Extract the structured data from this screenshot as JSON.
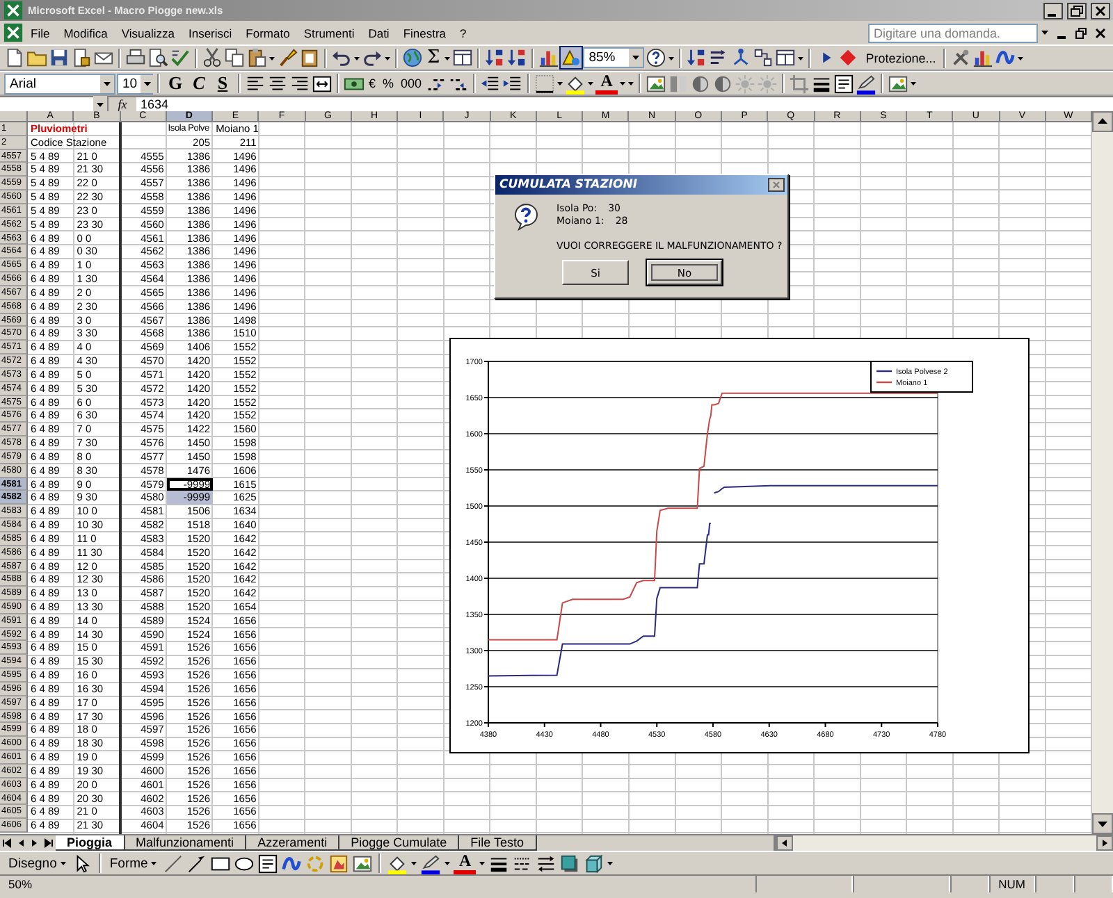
{
  "window": {
    "title": "Microsoft Excel - Macro Piogge new.xls"
  },
  "menu": {
    "items": [
      "File",
      "Modifica",
      "Visualizza",
      "Inserisci",
      "Formato",
      "Strumenti",
      "Dati",
      "Finestra",
      "?"
    ],
    "help_search": {
      "placeholder": "Digitare una domanda."
    }
  },
  "standard_toolbar": {
    "autosum": "Σ",
    "zoom": "85%",
    "protection": "Protezione..."
  },
  "formatting_toolbar": {
    "font": "Arial",
    "size": "10",
    "bold": "G",
    "italic": "C",
    "underline": "S",
    "euro": "€",
    "percent": "%",
    "thousands": "000",
    "font_color": "A"
  },
  "formula_bar": {
    "function_label": "fx",
    "value": "1634"
  },
  "sheet": {
    "columns": [
      {
        "label": "A",
        "selected": false
      },
      {
        "label": "B",
        "selected": false
      },
      {
        "label": "C",
        "selected": false
      },
      {
        "label": "D",
        "selected": true
      },
      {
        "label": "E",
        "selected": false
      },
      {
        "label": "F",
        "selected": false
      },
      {
        "label": "G",
        "selected": false
      },
      {
        "label": "H",
        "selected": false
      },
      {
        "label": "I",
        "selected": false
      },
      {
        "label": "J",
        "selected": false
      },
      {
        "label": "K",
        "selected": false
      },
      {
        "label": "L",
        "selected": false
      },
      {
        "label": "M",
        "selected": false
      },
      {
        "label": "N",
        "selected": false
      },
      {
        "label": "O",
        "selected": false
      },
      {
        "label": "P",
        "selected": false
      },
      {
        "label": "Q",
        "selected": false
      },
      {
        "label": "R",
        "selected": false
      },
      {
        "label": "S",
        "selected": false
      },
      {
        "label": "T",
        "selected": false
      },
      {
        "label": "U",
        "selected": false
      },
      {
        "label": "V",
        "selected": false
      },
      {
        "label": "W",
        "selected": false
      }
    ],
    "rows": [
      {
        "number": "1",
        "kind": "title",
        "A": "Pluviometri",
        "D": "Isola Polve",
        "E": "Moiano 1",
        "selected": false,
        "active": false
      },
      {
        "number": "2",
        "kind": "data",
        "A": "Codice Stazione",
        "D": "205",
        "E": "211",
        "selected": false,
        "active": false
      },
      {
        "number": "4557",
        "kind": "data",
        "A": "5 4 89",
        "B": "21 0",
        "C": "4555",
        "D": "1386",
        "E": "1496",
        "selected": false,
        "active": false
      },
      {
        "number": "4558",
        "kind": "data",
        "A": "5 4 89",
        "B": "21 30",
        "C": "4556",
        "D": "1386",
        "E": "1496",
        "selected": false,
        "active": false
      },
      {
        "number": "4559",
        "kind": "data",
        "A": "5 4 89",
        "B": "22 0",
        "C": "4557",
        "D": "1386",
        "E": "1496",
        "selected": false,
        "active": false
      },
      {
        "number": "4560",
        "kind": "data",
        "A": "5 4 89",
        "B": "22 30",
        "C": "4558",
        "D": "1386",
        "E": "1496",
        "selected": false,
        "active": false
      },
      {
        "number": "4561",
        "kind": "data",
        "A": "5 4 89",
        "B": "23 0",
        "C": "4559",
        "D": "1386",
        "E": "1496",
        "selected": false,
        "active": false
      },
      {
        "number": "4562",
        "kind": "data",
        "A": "5 4 89",
        "B": "23 30",
        "C": "4560",
        "D": "1386",
        "E": "1496",
        "selected": false,
        "active": false
      },
      {
        "number": "4563",
        "kind": "data",
        "A": "6 4 89",
        "B": "0 0",
        "C": "4561",
        "D": "1386",
        "E": "1496",
        "selected": false,
        "active": false
      },
      {
        "number": "4564",
        "kind": "data",
        "A": "6 4 89",
        "B": "0 30",
        "C": "4562",
        "D": "1386",
        "E": "1496",
        "selected": false,
        "active": false
      },
      {
        "number": "4565",
        "kind": "data",
        "A": "6 4 89",
        "B": "1 0",
        "C": "4563",
        "D": "1386",
        "E": "1496",
        "selected": false,
        "active": false
      },
      {
        "number": "4566",
        "kind": "data",
        "A": "6 4 89",
        "B": "1 30",
        "C": "4564",
        "D": "1386",
        "E": "1496",
        "selected": false,
        "active": false
      },
      {
        "number": "4567",
        "kind": "data",
        "A": "6 4 89",
        "B": "2 0",
        "C": "4565",
        "D": "1386",
        "E": "1496",
        "selected": false,
        "active": false
      },
      {
        "number": "4568",
        "kind": "data",
        "A": "6 4 89",
        "B": "2 30",
        "C": "4566",
        "D": "1386",
        "E": "1496",
        "selected": false,
        "active": false
      },
      {
        "number": "4569",
        "kind": "data",
        "A": "6 4 89",
        "B": "3 0",
        "C": "4567",
        "D": "1386",
        "E": "1498",
        "selected": false,
        "active": false
      },
      {
        "number": "4570",
        "kind": "data",
        "A": "6 4 89",
        "B": "3 30",
        "C": "4568",
        "D": "1386",
        "E": "1510",
        "selected": false,
        "active": false
      },
      {
        "number": "4571",
        "kind": "data",
        "A": "6 4 89",
        "B": "4 0",
        "C": "4569",
        "D": "1406",
        "E": "1552",
        "selected": false,
        "active": false
      },
      {
        "number": "4572",
        "kind": "data",
        "A": "6 4 89",
        "B": "4 30",
        "C": "4570",
        "D": "1420",
        "E": "1552",
        "selected": false,
        "active": false
      },
      {
        "number": "4573",
        "kind": "data",
        "A": "6 4 89",
        "B": "5 0",
        "C": "4571",
        "D": "1420",
        "E": "1552",
        "selected": false,
        "active": false
      },
      {
        "number": "4574",
        "kind": "data",
        "A": "6 4 89",
        "B": "5 30",
        "C": "4572",
        "D": "1420",
        "E": "1552",
        "selected": false,
        "active": false
      },
      {
        "number": "4575",
        "kind": "data",
        "A": "6 4 89",
        "B": "6 0",
        "C": "4573",
        "D": "1420",
        "E": "1552",
        "selected": false,
        "active": false
      },
      {
        "number": "4576",
        "kind": "data",
        "A": "6 4 89",
        "B": "6 30",
        "C": "4574",
        "D": "1420",
        "E": "1552",
        "selected": false,
        "active": false
      },
      {
        "number": "4577",
        "kind": "data",
        "A": "6 4 89",
        "B": "7 0",
        "C": "4575",
        "D": "1422",
        "E": "1560",
        "selected": false,
        "active": false
      },
      {
        "number": "4578",
        "kind": "data",
        "A": "6 4 89",
        "B": "7 30",
        "C": "4576",
        "D": "1450",
        "E": "1598",
        "selected": false,
        "active": false
      },
      {
        "number": "4579",
        "kind": "data",
        "A": "6 4 89",
        "B": "8 0",
        "C": "4577",
        "D": "1450",
        "E": "1598",
        "selected": false,
        "active": false
      },
      {
        "number": "4580",
        "kind": "data",
        "A": "6 4 89",
        "B": "8 30",
        "C": "4578",
        "D": "1476",
        "E": "1606",
        "selected": false,
        "active": false
      },
      {
        "number": "4581",
        "kind": "data",
        "A": "6 4 89",
        "B": "9 0",
        "C": "4579",
        "D": "-9999",
        "E": "1615",
        "selected": true,
        "active": true
      },
      {
        "number": "4582",
        "kind": "data",
        "A": "6 4 89",
        "B": "9 30",
        "C": "4580",
        "D": "-9999",
        "E": "1625",
        "selected": true,
        "active": false
      },
      {
        "number": "4583",
        "kind": "data",
        "A": "6 4 89",
        "B": "10 0",
        "C": "4581",
        "D": "1506",
        "E": "1634",
        "selected": false,
        "active": false
      },
      {
        "number": "4584",
        "kind": "data",
        "A": "6 4 89",
        "B": "10 30",
        "C": "4582",
        "D": "1518",
        "E": "1640",
        "selected": false,
        "active": false
      },
      {
        "number": "4585",
        "kind": "data",
        "A": "6 4 89",
        "B": "11 0",
        "C": "4583",
        "D": "1520",
        "E": "1642",
        "selected": false,
        "active": false
      },
      {
        "number": "4586",
        "kind": "data",
        "A": "6 4 89",
        "B": "11 30",
        "C": "4584",
        "D": "1520",
        "E": "1642",
        "selected": false,
        "active": false
      },
      {
        "number": "4587",
        "kind": "data",
        "A": "6 4 89",
        "B": "12 0",
        "C": "4585",
        "D": "1520",
        "E": "1642",
        "selected": false,
        "active": false
      },
      {
        "number": "4588",
        "kind": "data",
        "A": "6 4 89",
        "B": "12 30",
        "C": "4586",
        "D": "1520",
        "E": "1642",
        "selected": false,
        "active": false
      },
      {
        "number": "4589",
        "kind": "data",
        "A": "6 4 89",
        "B": "13 0",
        "C": "4587",
        "D": "1520",
        "E": "1642",
        "selected": false,
        "active": false
      },
      {
        "number": "4590",
        "kind": "data",
        "A": "6 4 89",
        "B": "13 30",
        "C": "4588",
        "D": "1520",
        "E": "1654",
        "selected": false,
        "active": false
      },
      {
        "number": "4591",
        "kind": "data",
        "A": "6 4 89",
        "B": "14 0",
        "C": "4589",
        "D": "1524",
        "E": "1656",
        "selected": false,
        "active": false
      },
      {
        "number": "4592",
        "kind": "data",
        "A": "6 4 89",
        "B": "14 30",
        "C": "4590",
        "D": "1524",
        "E": "1656",
        "selected": false,
        "active": false
      },
      {
        "number": "4593",
        "kind": "data",
        "A": "6 4 89",
        "B": "15 0",
        "C": "4591",
        "D": "1526",
        "E": "1656",
        "selected": false,
        "active": false
      },
      {
        "number": "4594",
        "kind": "data",
        "A": "6 4 89",
        "B": "15 30",
        "C": "4592",
        "D": "1526",
        "E": "1656",
        "selected": false,
        "active": false
      },
      {
        "number": "4595",
        "kind": "data",
        "A": "6 4 89",
        "B": "16 0",
        "C": "4593",
        "D": "1526",
        "E": "1656",
        "selected": false,
        "active": false
      },
      {
        "number": "4596",
        "kind": "data",
        "A": "6 4 89",
        "B": "16 30",
        "C": "4594",
        "D": "1526",
        "E": "1656",
        "selected": false,
        "active": false
      },
      {
        "number": "4597",
        "kind": "data",
        "A": "6 4 89",
        "B": "17 0",
        "C": "4595",
        "D": "1526",
        "E": "1656",
        "selected": false,
        "active": false
      },
      {
        "number": "4598",
        "kind": "data",
        "A": "6 4 89",
        "B": "17 30",
        "C": "4596",
        "D": "1526",
        "E": "1656",
        "selected": false,
        "active": false
      },
      {
        "number": "4599",
        "kind": "data",
        "A": "6 4 89",
        "B": "18 0",
        "C": "4597",
        "D": "1526",
        "E": "1656",
        "selected": false,
        "active": false
      },
      {
        "number": "4600",
        "kind": "data",
        "A": "6 4 89",
        "B": "18 30",
        "C": "4598",
        "D": "1526",
        "E": "1656",
        "selected": false,
        "active": false
      },
      {
        "number": "4601",
        "kind": "data",
        "A": "6 4 89",
        "B": "19 0",
        "C": "4599",
        "D": "1526",
        "E": "1656",
        "selected": false,
        "active": false
      },
      {
        "number": "4602",
        "kind": "data",
        "A": "6 4 89",
        "B": "19 30",
        "C": "4600",
        "D": "1526",
        "E": "1656",
        "selected": false,
        "active": false
      },
      {
        "number": "4603",
        "kind": "data",
        "A": "6 4 89",
        "B": "20 0",
        "C": "4601",
        "D": "1526",
        "E": "1656",
        "selected": false,
        "active": false
      },
      {
        "number": "4604",
        "kind": "data",
        "A": "6 4 89",
        "B": "20 30",
        "C": "4602",
        "D": "1526",
        "E": "1656",
        "selected": false,
        "active": false
      },
      {
        "number": "4605",
        "kind": "data",
        "A": "6 4 89",
        "B": "21 0",
        "C": "4603",
        "D": "1526",
        "E": "1656",
        "selected": false,
        "active": false
      },
      {
        "number": "4606",
        "kind": "data",
        "A": "6 4 89",
        "B": "21 30",
        "C": "4604",
        "D": "1526",
        "E": "1656",
        "selected": false,
        "active": false
      }
    ]
  },
  "chart": {
    "chart_data": {
      "type": "line",
      "x": [
        4380,
        4441,
        4446,
        4455,
        4500,
        4506,
        4512,
        4518,
        4528,
        4530,
        4533,
        4540,
        4566,
        4568,
        4572,
        4575,
        4576,
        4577,
        4578,
        4579,
        4580,
        4581,
        4585,
        4588,
        4590,
        4631,
        4780
      ],
      "series": [
        {
          "name": "Isola Polvese 2",
          "color": "#2a2a80",
          "values": [
            1265,
            1266,
            1309,
            1309,
            1309,
            1309,
            1313,
            1320,
            1320,
            1372,
            1387,
            1387,
            1387,
            1420,
            1420,
            1460,
            1460,
            1476,
            1476,
            null,
            null,
            1518,
            1520,
            1524,
            1526,
            1528,
            1528
          ]
        },
        {
          "name": "Moiano 1",
          "color": "#c84848",
          "values": [
            1315,
            1315,
            1366,
            1371,
            1371,
            1374,
            1394,
            1397,
            1397,
            1465,
            1494,
            1497,
            1497,
            1552,
            1555,
            1600,
            1610,
            1620,
            1625,
            1640,
            1640,
            1640,
            1642,
            1656,
            1656,
            1656,
            1656
          ]
        }
      ],
      "xlim": [
        4380,
        4780
      ],
      "ylim": [
        1200,
        1700
      ],
      "xticks": [
        4380,
        4430,
        4480,
        4530,
        4580,
        4630,
        4680,
        4730,
        4780
      ],
      "yticks": [
        1200,
        1250,
        1300,
        1350,
        1400,
        1450,
        1500,
        1550,
        1600,
        1650,
        1700
      ],
      "grid": true,
      "legend": "top right"
    }
  },
  "dialog": {
    "title": "CUMULATA STAZIONI",
    "lines": [
      {
        "label": "Isola Po:",
        "value": "30"
      },
      {
        "label": "Moiano 1:",
        "value": "28"
      }
    ],
    "question": "VUOI CORREGGERE IL MALFUNZIONAMENTO ?",
    "buttons": [
      {
        "label": "Si",
        "focused": false
      },
      {
        "label": "No",
        "focused": true
      }
    ]
  },
  "sheet_tabs": [
    {
      "label": "Pioggia",
      "selected": true
    },
    {
      "label": "Malfunzionamenti",
      "selected": false
    },
    {
      "label": "Azzeramenti",
      "selected": false
    },
    {
      "label": "Piogge Cumulate",
      "selected": false
    },
    {
      "label": "File Testo",
      "selected": false
    }
  ],
  "drawing_toolbar": {
    "draw": "Disegno",
    "shapes": "Forme",
    "font_color": "A"
  },
  "status_bar": {
    "zoom": "50%",
    "indicators": [
      "NUM"
    ]
  }
}
